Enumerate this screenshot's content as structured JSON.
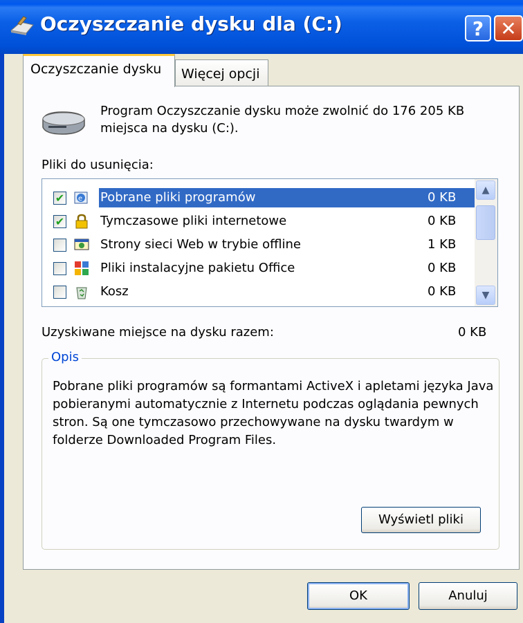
{
  "window": {
    "title": "Oczyszczanie dysku dla  (C:)",
    "help_label": "?",
    "close_label": "✕"
  },
  "tabs": [
    {
      "label": "Oczyszczanie dysku",
      "active": true
    },
    {
      "label": "Więcej opcji",
      "active": false
    }
  ],
  "summary_text": "Program Oczyszczanie dysku może zwolnić do 176 205 KB miejsca na dysku  (C:).",
  "files_label": "Pliki do usunięcia:",
  "files": [
    {
      "label": "Pobrane pliki programów",
      "size": "0 KB",
      "checked": true,
      "selected": true,
      "icon": "activex-icon"
    },
    {
      "label": "Tymczasowe pliki internetowe",
      "size": "0 KB",
      "checked": true,
      "selected": false,
      "icon": "lock-icon"
    },
    {
      "label": "Strony sieci Web w trybie offline",
      "size": "1 KB",
      "checked": false,
      "selected": false,
      "icon": "offline-web-icon"
    },
    {
      "label": "Pliki instalacyjne pakietu Office",
      "size": "0 KB",
      "checked": false,
      "selected": false,
      "icon": "office-icon"
    },
    {
      "label": "Kosz",
      "size": "0 KB",
      "checked": false,
      "selected": false,
      "icon": "recycle-bin-icon"
    }
  ],
  "check_mark": "✔",
  "total_label": "Uzyskiwane miejsce na dysku razem:",
  "total_value": "0 KB",
  "description": {
    "title": "Opis",
    "text": "Pobrane pliki programów są formantami ActiveX i apletami języka Java pobieranymi automatycznie z Internetu podczas oglądania pewnych stron. Są one tymczasowo przechowywane na dysku twardym w folderze Downloaded Program Files."
  },
  "buttons": {
    "view_files": "Wyświetl pliki",
    "ok": "OK",
    "cancel": "Anuluj"
  }
}
